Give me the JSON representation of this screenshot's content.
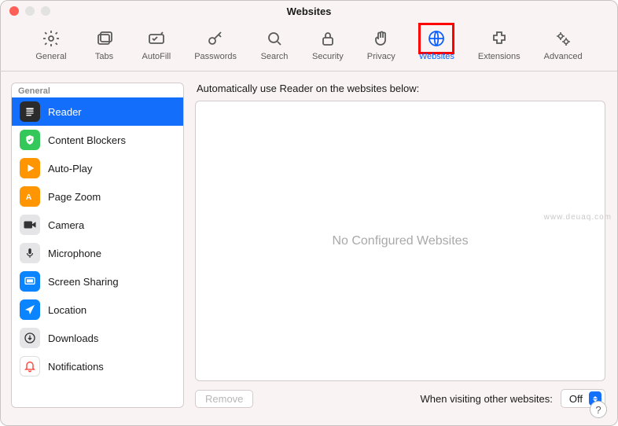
{
  "window_title": "Websites",
  "toolbar": [
    {
      "name": "general",
      "label": "General",
      "icon": "gear"
    },
    {
      "name": "tabs",
      "label": "Tabs",
      "icon": "tabs"
    },
    {
      "name": "autofill",
      "label": "AutoFill",
      "icon": "autofill"
    },
    {
      "name": "passwords",
      "label": "Passwords",
      "icon": "key"
    },
    {
      "name": "search",
      "label": "Search",
      "icon": "search"
    },
    {
      "name": "security",
      "label": "Security",
      "icon": "lock"
    },
    {
      "name": "privacy",
      "label": "Privacy",
      "icon": "hand"
    },
    {
      "name": "websites",
      "label": "Websites",
      "icon": "globe",
      "selected": true
    },
    {
      "name": "extensions",
      "label": "Extensions",
      "icon": "ext"
    },
    {
      "name": "advanced",
      "label": "Advanced",
      "icon": "gears"
    }
  ],
  "sidebar": {
    "header": "General",
    "items": [
      {
        "label": "Reader",
        "bg": "#2b2b2b",
        "icon": "reader",
        "selected": true
      },
      {
        "label": "Content Blockers",
        "bg": "#34c759",
        "icon": "shield"
      },
      {
        "label": "Auto-Play",
        "bg": "#ff9500",
        "icon": "play"
      },
      {
        "label": "Page Zoom",
        "bg": "#ff9500",
        "icon": "zoom"
      },
      {
        "label": "Camera",
        "bg": "#e5e5e7",
        "icon": "camera"
      },
      {
        "label": "Microphone",
        "bg": "#e5e5e7",
        "icon": "mic"
      },
      {
        "label": "Screen Sharing",
        "bg": "#0a84ff",
        "icon": "screen"
      },
      {
        "label": "Location",
        "bg": "#0a84ff",
        "icon": "arrow"
      },
      {
        "label": "Downloads",
        "bg": "#e5e5e7",
        "icon": "down"
      },
      {
        "label": "Notifications",
        "bg": "#ffffff",
        "icon": "bell"
      }
    ]
  },
  "main": {
    "heading": "Automatically use Reader on the websites below:",
    "empty_text": "No Configured Websites",
    "remove_label": "Remove",
    "other_label": "When visiting other websites:",
    "select_value": "Off"
  },
  "watermark": "www.deuaq.com"
}
